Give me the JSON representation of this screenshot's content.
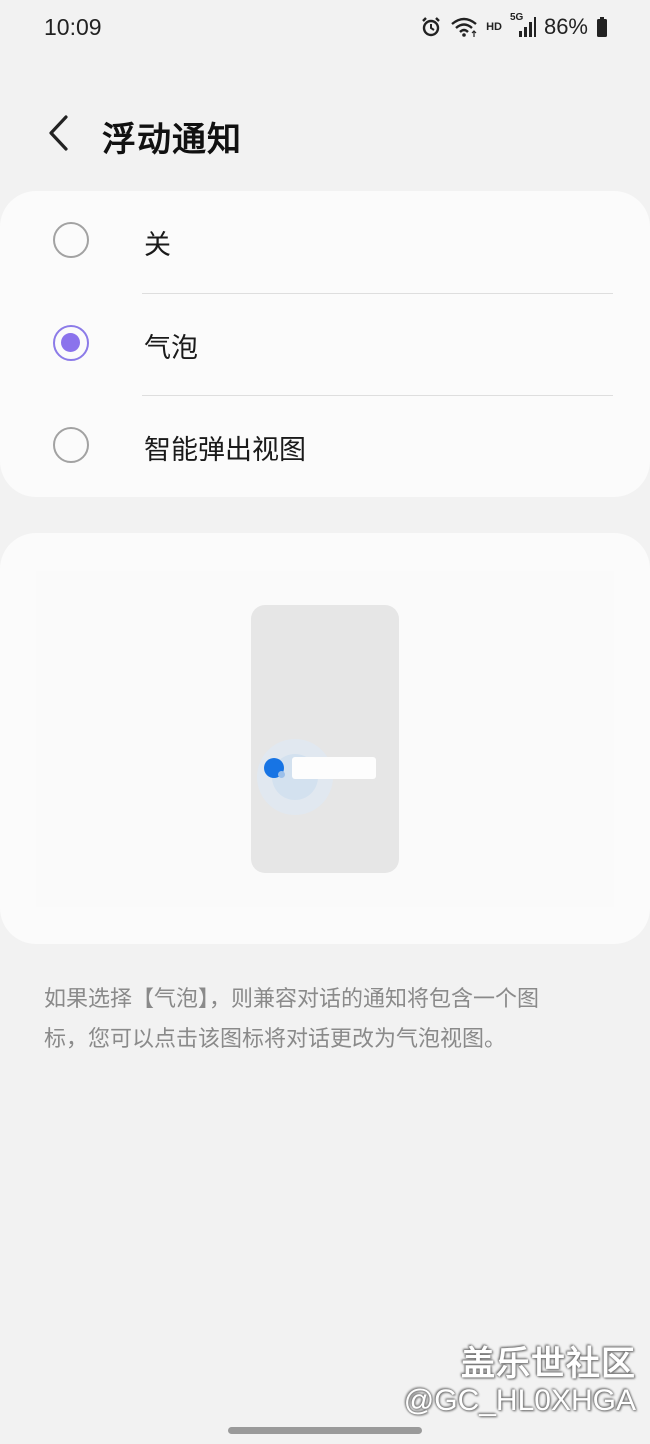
{
  "status_bar": {
    "time": "10:09",
    "network_hd": "HD",
    "network_type": "5G",
    "battery_percent": "86%",
    "icons": [
      "alarm-icon",
      "wifi-icon",
      "signal-icon",
      "battery-icon"
    ]
  },
  "header": {
    "title": "浮动通知",
    "back_icon": "chevron-left-icon"
  },
  "options": [
    {
      "label": "关",
      "selected": false
    },
    {
      "label": "气泡",
      "selected": true
    },
    {
      "label": "智能弹出视图",
      "selected": false
    }
  ],
  "description": {
    "line1": "如果选择【气泡】，则兼容对话的通知将包含一个图",
    "line2": "标，您可以点击该图标将对话更改为气泡视图。"
  },
  "watermark": {
    "site": "盖乐世社区",
    "handle": "@GC_HL0XHGA"
  },
  "colors": {
    "background": "#f2f2f2",
    "card": "#fbfbfb",
    "radio_accent": "#8b73ec",
    "bubble_blue": "#1774e4"
  }
}
